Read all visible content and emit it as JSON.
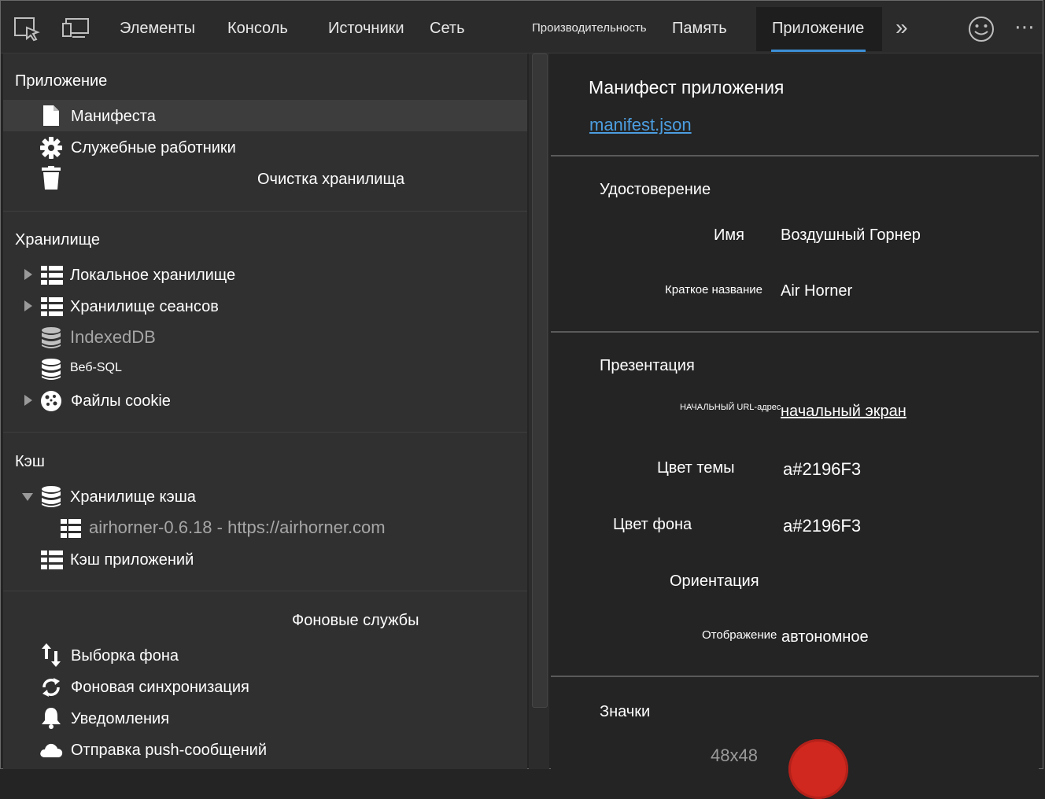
{
  "toolbar": {
    "tabs": [
      "Элементы",
      "Консоль",
      "Источники",
      "Сеть",
      "Производительность",
      "Память",
      "Приложение"
    ],
    "active_tab": "Приложение",
    "more_label": "»",
    "menu_label": "⋯"
  },
  "sidebar": {
    "app_section": "Приложение",
    "app_items": [
      "Манифеста",
      "Служебные работники",
      "Очистка хранилища"
    ],
    "storage_section": "Хранилище",
    "storage_items": [
      "Локальное хранилище",
      "Хранилище сеансов",
      "IndexedDB",
      "Веб-SQL",
      "Файлы cookie"
    ],
    "cache_section": "Кэш",
    "cache_items": [
      "Хранилище кэша",
      "airhorner-0.6.18 - https://airhorner.com",
      "Кэш приложений"
    ],
    "bg_section": "Фоновые службы",
    "bg_items": [
      "Выборка фона",
      "Фоновая синхронизация",
      "Уведомления",
      "Отправка push-сообщений"
    ]
  },
  "main": {
    "title": "Манифест приложения",
    "link": "manifest.json",
    "identity": {
      "section": "Удостоверение",
      "name_label": "Имя",
      "name_value": "Воздушный Горнер",
      "short_label": "Краткое название",
      "short_value": "Air Horner"
    },
    "presentation": {
      "section": "Презентация",
      "start_label": "НАЧАЛЬНЫЙ URL-адрес",
      "start_value": "начальный экран",
      "theme_label": "Цвет темы",
      "theme_value": "a#2196F3",
      "bg_label": "Цвет фона",
      "bg_value": "a#2196F3",
      "orientation_label": "Ориентация",
      "display_label": "Отображение",
      "display_value": "автономное"
    },
    "icons": {
      "section": "Значки",
      "size": "48x48"
    }
  }
}
